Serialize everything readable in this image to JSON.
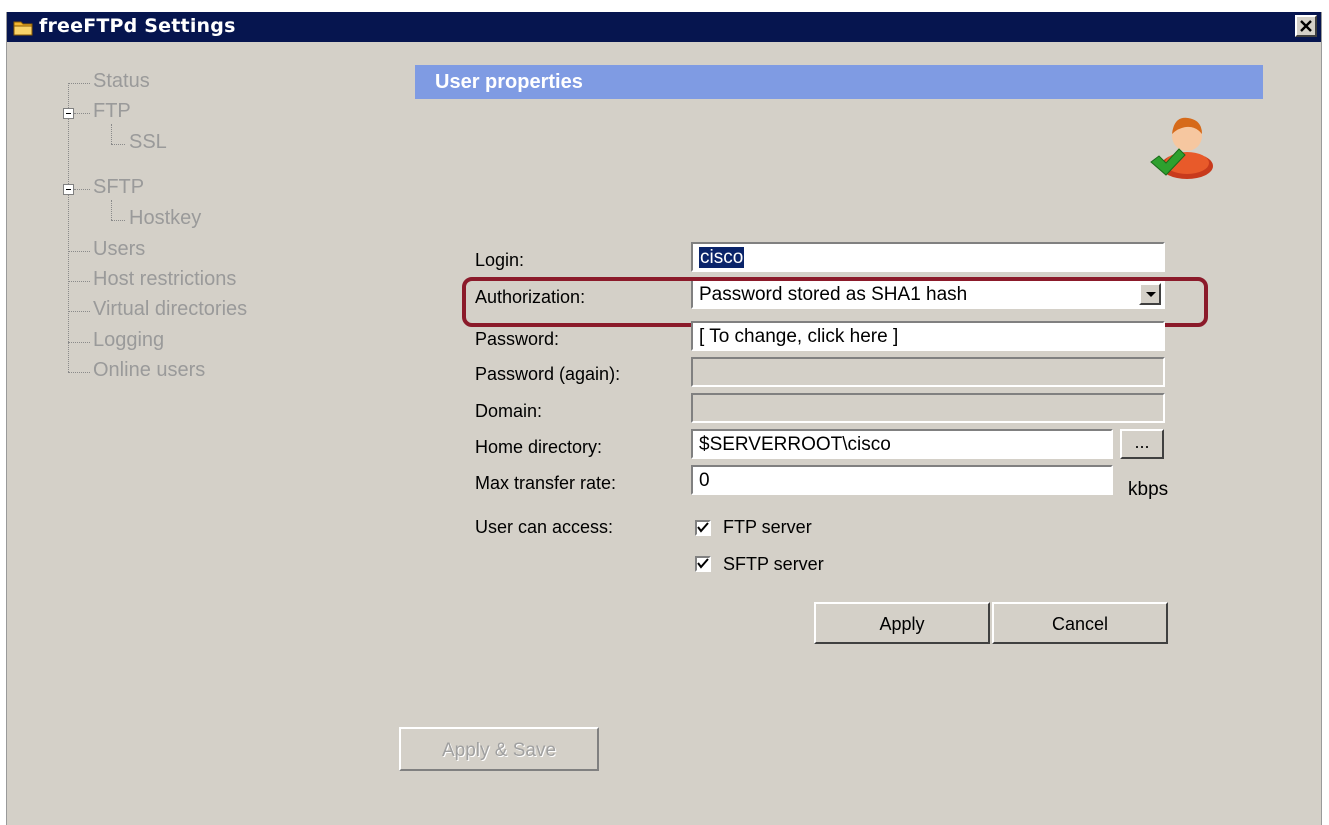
{
  "window": {
    "title": "freeFTPd Settings"
  },
  "tree": {
    "items": [
      "Status",
      "FTP",
      "SSL",
      "SFTP",
      "Hostkey",
      "Users",
      "Host restrictions",
      "Virtual directories",
      "Logging",
      "Online users"
    ]
  },
  "panel": {
    "header": "User properties",
    "login": {
      "label": "Login:",
      "value": "cisco"
    },
    "authorization": {
      "label": "Authorization:",
      "value": "Password stored as SHA1 hash"
    },
    "password": {
      "label": "Password:",
      "value": "[ To change, click here ]"
    },
    "password_again": {
      "label": "Password (again):",
      "value": ""
    },
    "domain": {
      "label": "Domain:",
      "value": ""
    },
    "home_directory": {
      "label": "Home directory:",
      "value": "$SERVERROOT\\cisco",
      "browse_label": "..."
    },
    "max_transfer_rate": {
      "label": "Max transfer rate:",
      "value": "0",
      "unit": "kbps"
    },
    "user_can_access": {
      "label": "User can access:",
      "options": [
        {
          "label": "FTP server",
          "checked": true
        },
        {
          "label": "SFTP server",
          "checked": true
        }
      ]
    },
    "apply_label": "Apply",
    "cancel_label": "Cancel"
  },
  "footer": {
    "apply_save_label": "Apply & Save"
  },
  "colors": {
    "title_bar": "#06154f",
    "panel_header": "#7f9be3",
    "window_bg": "#d4d0c8",
    "highlight_outline": "#8b1a2a"
  },
  "icons": {
    "app": "folder-icon",
    "user": "user-check-icon",
    "close": "close-icon"
  }
}
